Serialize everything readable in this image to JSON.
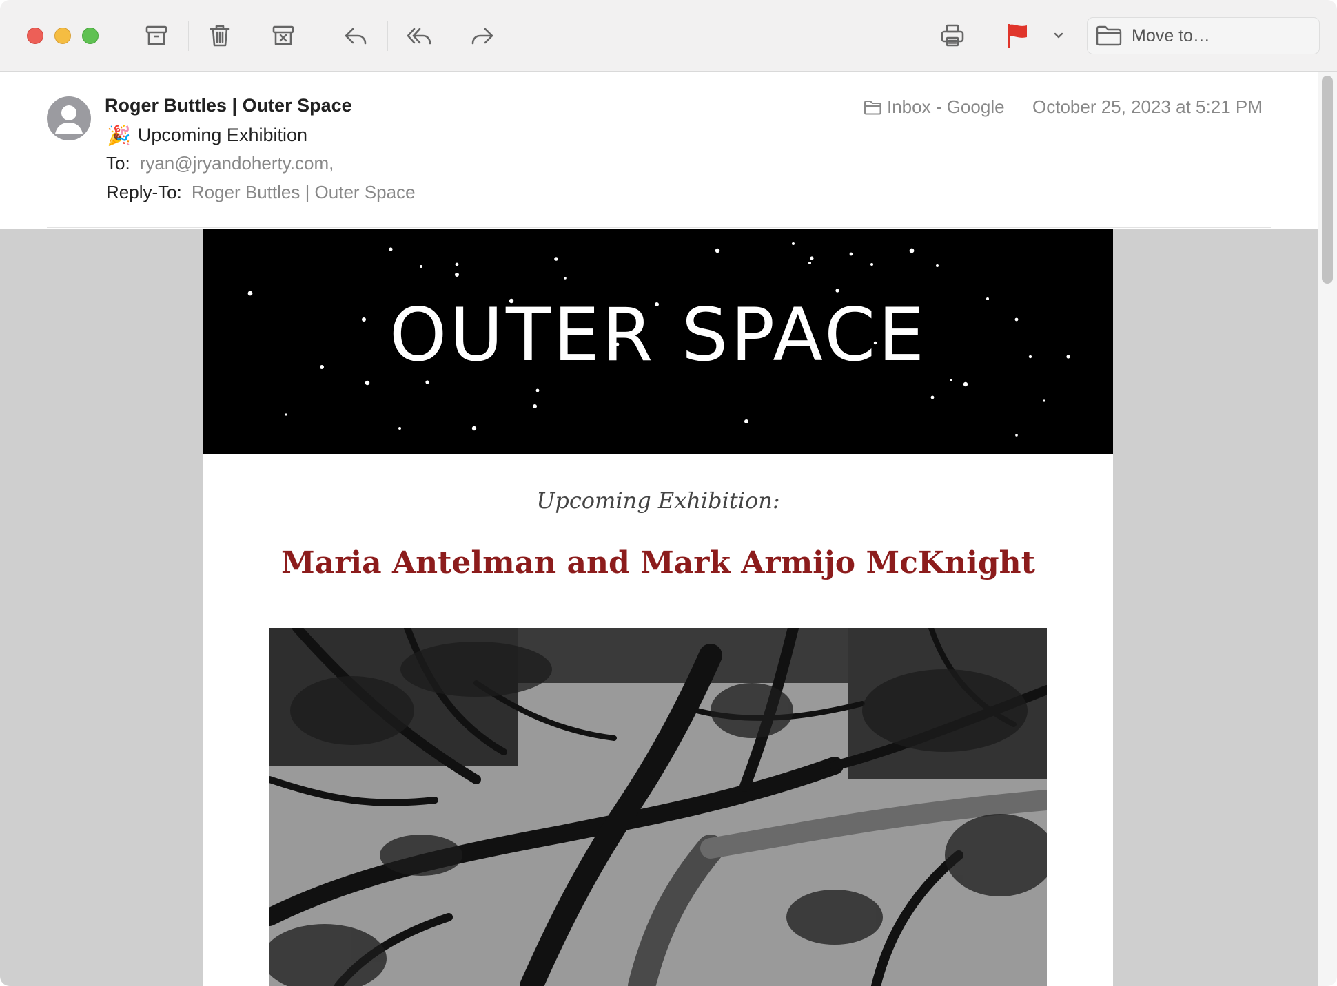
{
  "window": {
    "controls": [
      "close",
      "minimize",
      "zoom"
    ]
  },
  "toolbar": {
    "buttons": [
      {
        "name": "archive",
        "icon": "archive-icon"
      },
      {
        "name": "delete",
        "icon": "trash-icon"
      },
      {
        "name": "junk",
        "icon": "junk-icon"
      },
      {
        "name": "reply",
        "icon": "reply-icon"
      },
      {
        "name": "reply-all",
        "icon": "reply-all-icon"
      },
      {
        "name": "forward",
        "icon": "forward-icon"
      },
      {
        "name": "print",
        "icon": "printer-icon"
      },
      {
        "name": "flag",
        "icon": "flag-icon"
      }
    ],
    "flag_color": "#e0352b",
    "move_to_label": "Move to…"
  },
  "message": {
    "sender": "Roger Buttles | Outer Space",
    "subject_emoji": "🎉",
    "subject": "Upcoming Exhibition",
    "to_label": "To:",
    "to_value": "ryan@jryandoherty.com,",
    "reply_to_label": "Reply-To:",
    "reply_to_value": "Roger Buttles | Outer Space",
    "mailbox": "Inbox - Google",
    "date": "October 25, 2023 at 5:21 PM"
  },
  "email_body": {
    "banner_logo": "OUTER SPACE",
    "intro": "Upcoming Exhibition:",
    "artists": "Maria Antelman and Mark Armijo McKnight",
    "accent_color": "#8c1c1c"
  }
}
